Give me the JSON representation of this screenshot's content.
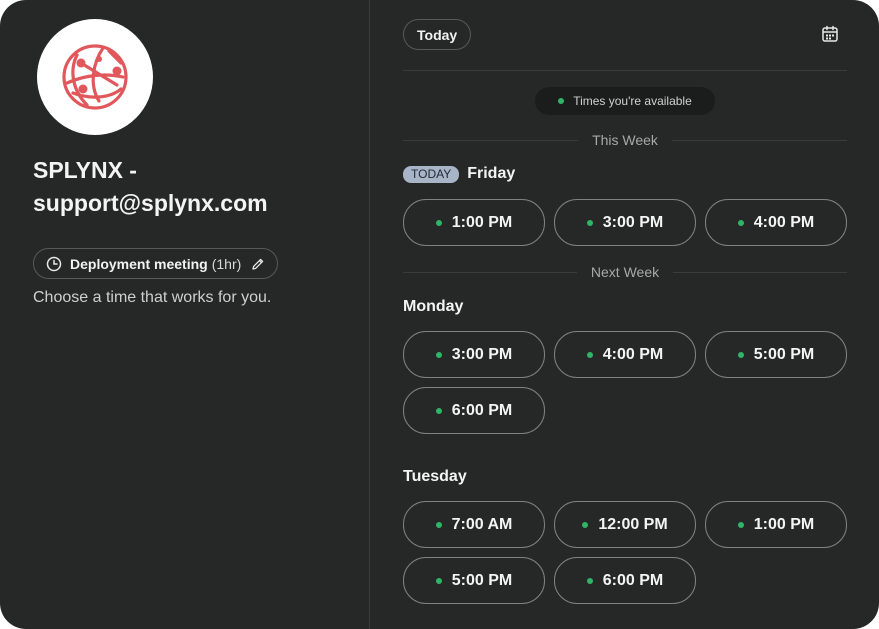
{
  "organizer": {
    "title": "SPLYNX - support@splynx.com",
    "logo_icon": "splynx-logo-icon",
    "brand_color": "#e0585b"
  },
  "meeting": {
    "name": "Deployment meeting",
    "duration": "(1hr)",
    "icons": [
      "clock-icon",
      "pencil-icon"
    ]
  },
  "subtitle": "Choose a time that works for you.",
  "toolbar": {
    "today_label": "Today",
    "calendar_icon": "calendar-icon"
  },
  "legend": {
    "label": "Times you're available",
    "available_color": "#2fb567"
  },
  "weeks": [
    {
      "label": "This Week",
      "days": [
        {
          "badge": "TODAY",
          "name": "Friday",
          "slots": [
            "1:00 PM",
            "3:00 PM",
            "4:00 PM"
          ]
        }
      ]
    },
    {
      "label": "Next Week",
      "days": [
        {
          "name": "Monday",
          "slots": [
            "3:00 PM",
            "4:00 PM",
            "5:00 PM",
            "6:00 PM"
          ]
        },
        {
          "name": "Tuesday",
          "slots": [
            "7:00 AM",
            "12:00 PM",
            "1:00 PM",
            "5:00 PM",
            "6:00 PM"
          ]
        }
      ]
    }
  ]
}
